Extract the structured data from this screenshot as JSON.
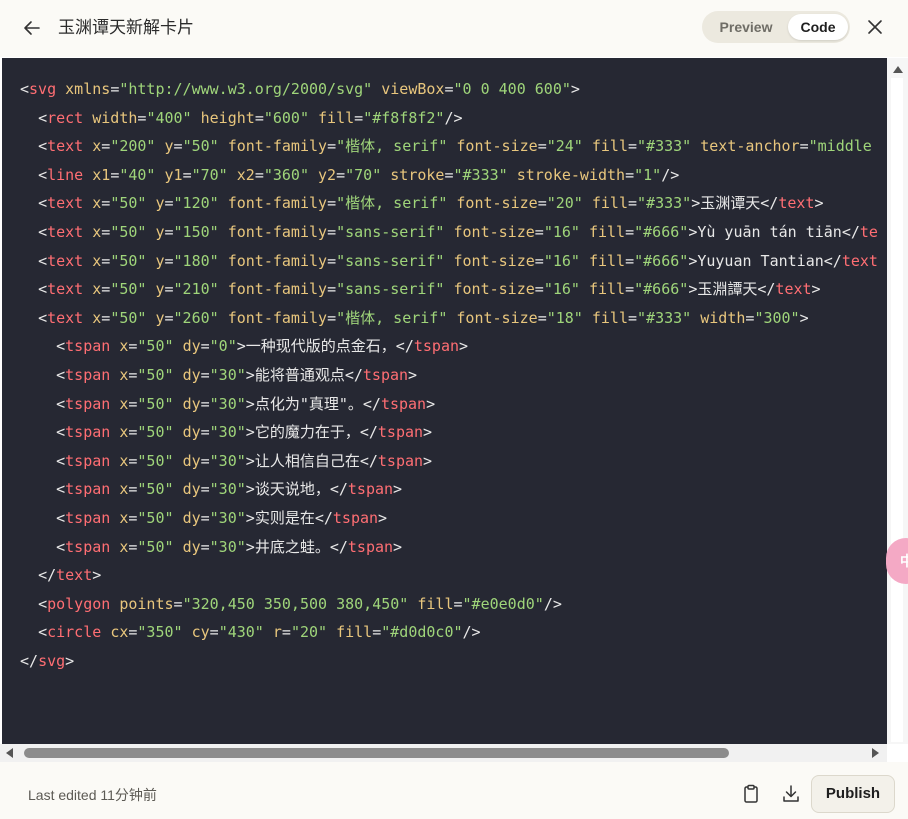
{
  "header": {
    "title": "玉渊谭天新解卡片",
    "toggle": {
      "preview_label": "Preview",
      "code_label": "Code",
      "active": "Code"
    }
  },
  "code_lines": [
    [
      [
        "punct",
        "<"
      ],
      [
        "tag",
        "svg"
      ],
      [
        "txt",
        " "
      ],
      [
        "attr",
        "xmlns"
      ],
      [
        "punct",
        "="
      ],
      [
        "str",
        "\"http://www.w3.org/2000/svg\""
      ],
      [
        "txt",
        " "
      ],
      [
        "attr",
        "viewBox"
      ],
      [
        "punct",
        "="
      ],
      [
        "str",
        "\"0 0 400 600\""
      ],
      [
        "punct",
        ">"
      ]
    ],
    [
      [
        "txt",
        "  "
      ],
      [
        "punct",
        "<"
      ],
      [
        "tag",
        "rect"
      ],
      [
        "txt",
        " "
      ],
      [
        "attr",
        "width"
      ],
      [
        "punct",
        "="
      ],
      [
        "str",
        "\"400\""
      ],
      [
        "txt",
        " "
      ],
      [
        "attr",
        "height"
      ],
      [
        "punct",
        "="
      ],
      [
        "str",
        "\"600\""
      ],
      [
        "txt",
        " "
      ],
      [
        "attr",
        "fill"
      ],
      [
        "punct",
        "="
      ],
      [
        "str",
        "\"#f8f8f2\""
      ],
      [
        "punct",
        "/>"
      ]
    ],
    [
      [
        "txt",
        "  "
      ],
      [
        "punct",
        "<"
      ],
      [
        "tag",
        "text"
      ],
      [
        "txt",
        " "
      ],
      [
        "attr",
        "x"
      ],
      [
        "punct",
        "="
      ],
      [
        "str",
        "\"200\""
      ],
      [
        "txt",
        " "
      ],
      [
        "attr",
        "y"
      ],
      [
        "punct",
        "="
      ],
      [
        "str",
        "\"50\""
      ],
      [
        "txt",
        " "
      ],
      [
        "attr",
        "font-family"
      ],
      [
        "punct",
        "="
      ],
      [
        "str",
        "\"楷体, serif\""
      ],
      [
        "txt",
        " "
      ],
      [
        "attr",
        "font-size"
      ],
      [
        "punct",
        "="
      ],
      [
        "str",
        "\"24\""
      ],
      [
        "txt",
        " "
      ],
      [
        "attr",
        "fill"
      ],
      [
        "punct",
        "="
      ],
      [
        "str",
        "\"#333\""
      ],
      [
        "txt",
        " "
      ],
      [
        "attr",
        "text-anchor"
      ],
      [
        "punct",
        "="
      ],
      [
        "str",
        "\"middle"
      ]
    ],
    [
      [
        "txt",
        "  "
      ],
      [
        "punct",
        "<"
      ],
      [
        "tag",
        "line"
      ],
      [
        "txt",
        " "
      ],
      [
        "attr",
        "x1"
      ],
      [
        "punct",
        "="
      ],
      [
        "str",
        "\"40\""
      ],
      [
        "txt",
        " "
      ],
      [
        "attr",
        "y1"
      ],
      [
        "punct",
        "="
      ],
      [
        "str",
        "\"70\""
      ],
      [
        "txt",
        " "
      ],
      [
        "attr",
        "x2"
      ],
      [
        "punct",
        "="
      ],
      [
        "str",
        "\"360\""
      ],
      [
        "txt",
        " "
      ],
      [
        "attr",
        "y2"
      ],
      [
        "punct",
        "="
      ],
      [
        "str",
        "\"70\""
      ],
      [
        "txt",
        " "
      ],
      [
        "attr",
        "stroke"
      ],
      [
        "punct",
        "="
      ],
      [
        "str",
        "\"#333\""
      ],
      [
        "txt",
        " "
      ],
      [
        "attr",
        "stroke-width"
      ],
      [
        "punct",
        "="
      ],
      [
        "str",
        "\"1\""
      ],
      [
        "punct",
        "/>"
      ]
    ],
    [
      [
        "txt",
        "  "
      ],
      [
        "punct",
        "<"
      ],
      [
        "tag",
        "text"
      ],
      [
        "txt",
        " "
      ],
      [
        "attr",
        "x"
      ],
      [
        "punct",
        "="
      ],
      [
        "str",
        "\"50\""
      ],
      [
        "txt",
        " "
      ],
      [
        "attr",
        "y"
      ],
      [
        "punct",
        "="
      ],
      [
        "str",
        "\"120\""
      ],
      [
        "txt",
        " "
      ],
      [
        "attr",
        "font-family"
      ],
      [
        "punct",
        "="
      ],
      [
        "str",
        "\"楷体, serif\""
      ],
      [
        "txt",
        " "
      ],
      [
        "attr",
        "font-size"
      ],
      [
        "punct",
        "="
      ],
      [
        "str",
        "\"20\""
      ],
      [
        "txt",
        " "
      ],
      [
        "attr",
        "fill"
      ],
      [
        "punct",
        "="
      ],
      [
        "str",
        "\"#333\""
      ],
      [
        "punct",
        ">"
      ],
      [
        "txt",
        "玉渊谭天"
      ],
      [
        "punct",
        "</"
      ],
      [
        "tag",
        "text"
      ],
      [
        "punct",
        ">"
      ]
    ],
    [
      [
        "txt",
        "  "
      ],
      [
        "punct",
        "<"
      ],
      [
        "tag",
        "text"
      ],
      [
        "txt",
        " "
      ],
      [
        "attr",
        "x"
      ],
      [
        "punct",
        "="
      ],
      [
        "str",
        "\"50\""
      ],
      [
        "txt",
        " "
      ],
      [
        "attr",
        "y"
      ],
      [
        "punct",
        "="
      ],
      [
        "str",
        "\"150\""
      ],
      [
        "txt",
        " "
      ],
      [
        "attr",
        "font-family"
      ],
      [
        "punct",
        "="
      ],
      [
        "str",
        "\"sans-serif\""
      ],
      [
        "txt",
        " "
      ],
      [
        "attr",
        "font-size"
      ],
      [
        "punct",
        "="
      ],
      [
        "str",
        "\"16\""
      ],
      [
        "txt",
        " "
      ],
      [
        "attr",
        "fill"
      ],
      [
        "punct",
        "="
      ],
      [
        "str",
        "\"#666\""
      ],
      [
        "punct",
        ">"
      ],
      [
        "txt",
        "Yù yuān tán tiān"
      ],
      [
        "punct",
        "</"
      ],
      [
        "tag",
        "te"
      ]
    ],
    [
      [
        "txt",
        "  "
      ],
      [
        "punct",
        "<"
      ],
      [
        "tag",
        "text"
      ],
      [
        "txt",
        " "
      ],
      [
        "attr",
        "x"
      ],
      [
        "punct",
        "="
      ],
      [
        "str",
        "\"50\""
      ],
      [
        "txt",
        " "
      ],
      [
        "attr",
        "y"
      ],
      [
        "punct",
        "="
      ],
      [
        "str",
        "\"180\""
      ],
      [
        "txt",
        " "
      ],
      [
        "attr",
        "font-family"
      ],
      [
        "punct",
        "="
      ],
      [
        "str",
        "\"sans-serif\""
      ],
      [
        "txt",
        " "
      ],
      [
        "attr",
        "font-size"
      ],
      [
        "punct",
        "="
      ],
      [
        "str",
        "\"16\""
      ],
      [
        "txt",
        " "
      ],
      [
        "attr",
        "fill"
      ],
      [
        "punct",
        "="
      ],
      [
        "str",
        "\"#666\""
      ],
      [
        "punct",
        ">"
      ],
      [
        "txt",
        "Yuyuan Tantian"
      ],
      [
        "punct",
        "</"
      ],
      [
        "tag",
        "text"
      ]
    ],
    [
      [
        "txt",
        "  "
      ],
      [
        "punct",
        "<"
      ],
      [
        "tag",
        "text"
      ],
      [
        "txt",
        " "
      ],
      [
        "attr",
        "x"
      ],
      [
        "punct",
        "="
      ],
      [
        "str",
        "\"50\""
      ],
      [
        "txt",
        " "
      ],
      [
        "attr",
        "y"
      ],
      [
        "punct",
        "="
      ],
      [
        "str",
        "\"210\""
      ],
      [
        "txt",
        " "
      ],
      [
        "attr",
        "font-family"
      ],
      [
        "punct",
        "="
      ],
      [
        "str",
        "\"sans-serif\""
      ],
      [
        "txt",
        " "
      ],
      [
        "attr",
        "font-size"
      ],
      [
        "punct",
        "="
      ],
      [
        "str",
        "\"16\""
      ],
      [
        "txt",
        " "
      ],
      [
        "attr",
        "fill"
      ],
      [
        "punct",
        "="
      ],
      [
        "str",
        "\"#666\""
      ],
      [
        "punct",
        ">"
      ],
      [
        "txt",
        "玉淵譚天"
      ],
      [
        "punct",
        "</"
      ],
      [
        "tag",
        "text"
      ],
      [
        "punct",
        ">"
      ]
    ],
    [
      [
        "txt",
        "  "
      ],
      [
        "punct",
        "<"
      ],
      [
        "tag",
        "text"
      ],
      [
        "txt",
        " "
      ],
      [
        "attr",
        "x"
      ],
      [
        "punct",
        "="
      ],
      [
        "str",
        "\"50\""
      ],
      [
        "txt",
        " "
      ],
      [
        "attr",
        "y"
      ],
      [
        "punct",
        "="
      ],
      [
        "str",
        "\"260\""
      ],
      [
        "txt",
        " "
      ],
      [
        "attr",
        "font-family"
      ],
      [
        "punct",
        "="
      ],
      [
        "str",
        "\"楷体, serif\""
      ],
      [
        "txt",
        " "
      ],
      [
        "attr",
        "font-size"
      ],
      [
        "punct",
        "="
      ],
      [
        "str",
        "\"18\""
      ],
      [
        "txt",
        " "
      ],
      [
        "attr",
        "fill"
      ],
      [
        "punct",
        "="
      ],
      [
        "str",
        "\"#333\""
      ],
      [
        "txt",
        " "
      ],
      [
        "attr",
        "width"
      ],
      [
        "punct",
        "="
      ],
      [
        "str",
        "\"300\""
      ],
      [
        "punct",
        ">"
      ]
    ],
    [
      [
        "txt",
        "    "
      ],
      [
        "punct",
        "<"
      ],
      [
        "tag",
        "tspan"
      ],
      [
        "txt",
        " "
      ],
      [
        "attr",
        "x"
      ],
      [
        "punct",
        "="
      ],
      [
        "str",
        "\"50\""
      ],
      [
        "txt",
        " "
      ],
      [
        "attr",
        "dy"
      ],
      [
        "punct",
        "="
      ],
      [
        "str",
        "\"0\""
      ],
      [
        "punct",
        ">"
      ],
      [
        "txt",
        "一种现代版的点金石，"
      ],
      [
        "punct",
        "</"
      ],
      [
        "tag",
        "tspan"
      ],
      [
        "punct",
        ">"
      ]
    ],
    [
      [
        "txt",
        "    "
      ],
      [
        "punct",
        "<"
      ],
      [
        "tag",
        "tspan"
      ],
      [
        "txt",
        " "
      ],
      [
        "attr",
        "x"
      ],
      [
        "punct",
        "="
      ],
      [
        "str",
        "\"50\""
      ],
      [
        "txt",
        " "
      ],
      [
        "attr",
        "dy"
      ],
      [
        "punct",
        "="
      ],
      [
        "str",
        "\"30\""
      ],
      [
        "punct",
        ">"
      ],
      [
        "txt",
        "能将普通观点"
      ],
      [
        "punct",
        "</"
      ],
      [
        "tag",
        "tspan"
      ],
      [
        "punct",
        ">"
      ]
    ],
    [
      [
        "txt",
        "    "
      ],
      [
        "punct",
        "<"
      ],
      [
        "tag",
        "tspan"
      ],
      [
        "txt",
        " "
      ],
      [
        "attr",
        "x"
      ],
      [
        "punct",
        "="
      ],
      [
        "str",
        "\"50\""
      ],
      [
        "txt",
        " "
      ],
      [
        "attr",
        "dy"
      ],
      [
        "punct",
        "="
      ],
      [
        "str",
        "\"30\""
      ],
      [
        "punct",
        ">"
      ],
      [
        "txt",
        "点化为\"真理\"。"
      ],
      [
        "punct",
        "</"
      ],
      [
        "tag",
        "tspan"
      ],
      [
        "punct",
        ">"
      ]
    ],
    [
      [
        "txt",
        "    "
      ],
      [
        "punct",
        "<"
      ],
      [
        "tag",
        "tspan"
      ],
      [
        "txt",
        " "
      ],
      [
        "attr",
        "x"
      ],
      [
        "punct",
        "="
      ],
      [
        "str",
        "\"50\""
      ],
      [
        "txt",
        " "
      ],
      [
        "attr",
        "dy"
      ],
      [
        "punct",
        "="
      ],
      [
        "str",
        "\"30\""
      ],
      [
        "punct",
        ">"
      ],
      [
        "txt",
        "它的魔力在于，"
      ],
      [
        "punct",
        "</"
      ],
      [
        "tag",
        "tspan"
      ],
      [
        "punct",
        ">"
      ]
    ],
    [
      [
        "txt",
        "    "
      ],
      [
        "punct",
        "<"
      ],
      [
        "tag",
        "tspan"
      ],
      [
        "txt",
        " "
      ],
      [
        "attr",
        "x"
      ],
      [
        "punct",
        "="
      ],
      [
        "str",
        "\"50\""
      ],
      [
        "txt",
        " "
      ],
      [
        "attr",
        "dy"
      ],
      [
        "punct",
        "="
      ],
      [
        "str",
        "\"30\""
      ],
      [
        "punct",
        ">"
      ],
      [
        "txt",
        "让人相信自己在"
      ],
      [
        "punct",
        "</"
      ],
      [
        "tag",
        "tspan"
      ],
      [
        "punct",
        ">"
      ]
    ],
    [
      [
        "txt",
        "    "
      ],
      [
        "punct",
        "<"
      ],
      [
        "tag",
        "tspan"
      ],
      [
        "txt",
        " "
      ],
      [
        "attr",
        "x"
      ],
      [
        "punct",
        "="
      ],
      [
        "str",
        "\"50\""
      ],
      [
        "txt",
        " "
      ],
      [
        "attr",
        "dy"
      ],
      [
        "punct",
        "="
      ],
      [
        "str",
        "\"30\""
      ],
      [
        "punct",
        ">"
      ],
      [
        "txt",
        "谈天说地，"
      ],
      [
        "punct",
        "</"
      ],
      [
        "tag",
        "tspan"
      ],
      [
        "punct",
        ">"
      ]
    ],
    [
      [
        "txt",
        "    "
      ],
      [
        "punct",
        "<"
      ],
      [
        "tag",
        "tspan"
      ],
      [
        "txt",
        " "
      ],
      [
        "attr",
        "x"
      ],
      [
        "punct",
        "="
      ],
      [
        "str",
        "\"50\""
      ],
      [
        "txt",
        " "
      ],
      [
        "attr",
        "dy"
      ],
      [
        "punct",
        "="
      ],
      [
        "str",
        "\"30\""
      ],
      [
        "punct",
        ">"
      ],
      [
        "txt",
        "实则是在"
      ],
      [
        "punct",
        "</"
      ],
      [
        "tag",
        "tspan"
      ],
      [
        "punct",
        ">"
      ]
    ],
    [
      [
        "txt",
        "    "
      ],
      [
        "punct",
        "<"
      ],
      [
        "tag",
        "tspan"
      ],
      [
        "txt",
        " "
      ],
      [
        "attr",
        "x"
      ],
      [
        "punct",
        "="
      ],
      [
        "str",
        "\"50\""
      ],
      [
        "txt",
        " "
      ],
      [
        "attr",
        "dy"
      ],
      [
        "punct",
        "="
      ],
      [
        "str",
        "\"30\""
      ],
      [
        "punct",
        ">"
      ],
      [
        "txt",
        "井底之蛙。"
      ],
      [
        "punct",
        "</"
      ],
      [
        "tag",
        "tspan"
      ],
      [
        "punct",
        ">"
      ]
    ],
    [
      [
        "txt",
        "  "
      ],
      [
        "punct",
        "</"
      ],
      [
        "tag",
        "text"
      ],
      [
        "punct",
        ">"
      ]
    ],
    [
      [
        "txt",
        "  "
      ],
      [
        "punct",
        "<"
      ],
      [
        "tag",
        "polygon"
      ],
      [
        "txt",
        " "
      ],
      [
        "attr",
        "points"
      ],
      [
        "punct",
        "="
      ],
      [
        "str",
        "\"320,450 350,500 380,450\""
      ],
      [
        "txt",
        " "
      ],
      [
        "attr",
        "fill"
      ],
      [
        "punct",
        "="
      ],
      [
        "str",
        "\"#e0e0d0\""
      ],
      [
        "punct",
        "/>"
      ]
    ],
    [
      [
        "txt",
        "  "
      ],
      [
        "punct",
        "<"
      ],
      [
        "tag",
        "circle"
      ],
      [
        "txt",
        " "
      ],
      [
        "attr",
        "cx"
      ],
      [
        "punct",
        "="
      ],
      [
        "str",
        "\"350\""
      ],
      [
        "txt",
        " "
      ],
      [
        "attr",
        "cy"
      ],
      [
        "punct",
        "="
      ],
      [
        "str",
        "\"430\""
      ],
      [
        "txt",
        " "
      ],
      [
        "attr",
        "r"
      ],
      [
        "punct",
        "="
      ],
      [
        "str",
        "\"20\""
      ],
      [
        "txt",
        " "
      ],
      [
        "attr",
        "fill"
      ],
      [
        "punct",
        "="
      ],
      [
        "str",
        "\"#d0d0c0\""
      ],
      [
        "punct",
        "/>"
      ]
    ],
    [
      [
        "punct",
        "</"
      ],
      [
        "tag",
        "svg"
      ],
      [
        "punct",
        ">"
      ]
    ]
  ],
  "footer": {
    "edited_text": "Last edited 11分钟前",
    "publish_label": "Publish"
  },
  "floating_badge": {
    "glyph": "中"
  },
  "icons": {
    "back": "arrow-left-icon",
    "close": "close-icon",
    "copy": "clipboard-icon",
    "download": "download-icon"
  },
  "colors": {
    "code_bg": "#262833",
    "tag": "#ff6e73",
    "attr": "#e8c67d",
    "string": "#9fd57a",
    "text": "#e8e8e8",
    "header_bg": "#fbfaf6"
  }
}
